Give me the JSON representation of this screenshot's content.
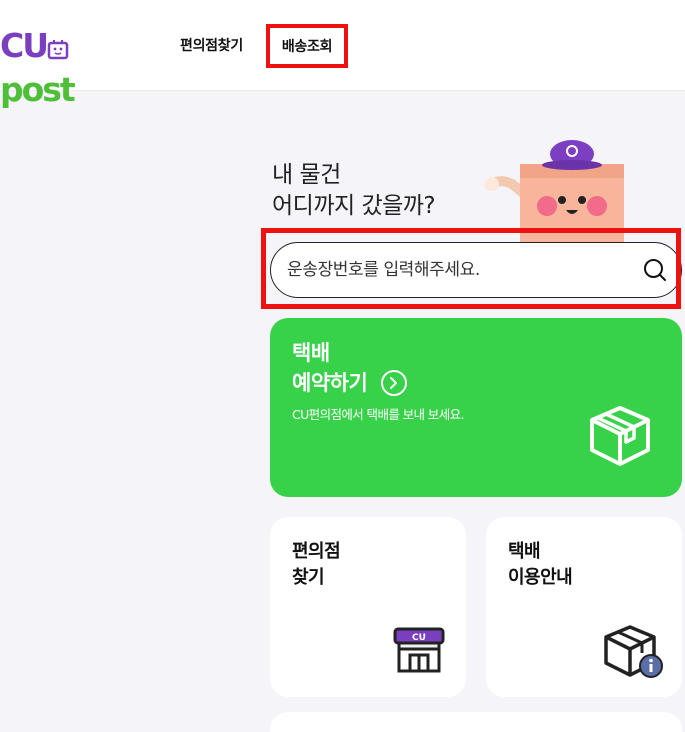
{
  "header": {
    "logo_text_cu": "CU",
    "logo_text_post": "post",
    "nav_find_store": "편의점찾기",
    "nav_track": "배송조회"
  },
  "hero": {
    "headline_line1": "내 물건",
    "headline_line2": "어디까지 갔을까?"
  },
  "search": {
    "placeholder": "운송장번호를 입력해주세요."
  },
  "reserve_card": {
    "title_line1": "택배",
    "title_line2": "예약하기",
    "subtitle": "CU편의점에서 택배를 보내 보세요.",
    "bg_color": "#38d14a"
  },
  "store_card": {
    "title_line1": "편의점",
    "title_line2": "찾기",
    "icon_label": "CU"
  },
  "guide_card": {
    "title_line1": "택배",
    "title_line2": "이용안내"
  },
  "colors": {
    "brand_purple": "#7a3fbf",
    "brand_green": "#4fbf3a",
    "highlight_red": "#ee1111",
    "page_bg": "#f4f4f9"
  }
}
